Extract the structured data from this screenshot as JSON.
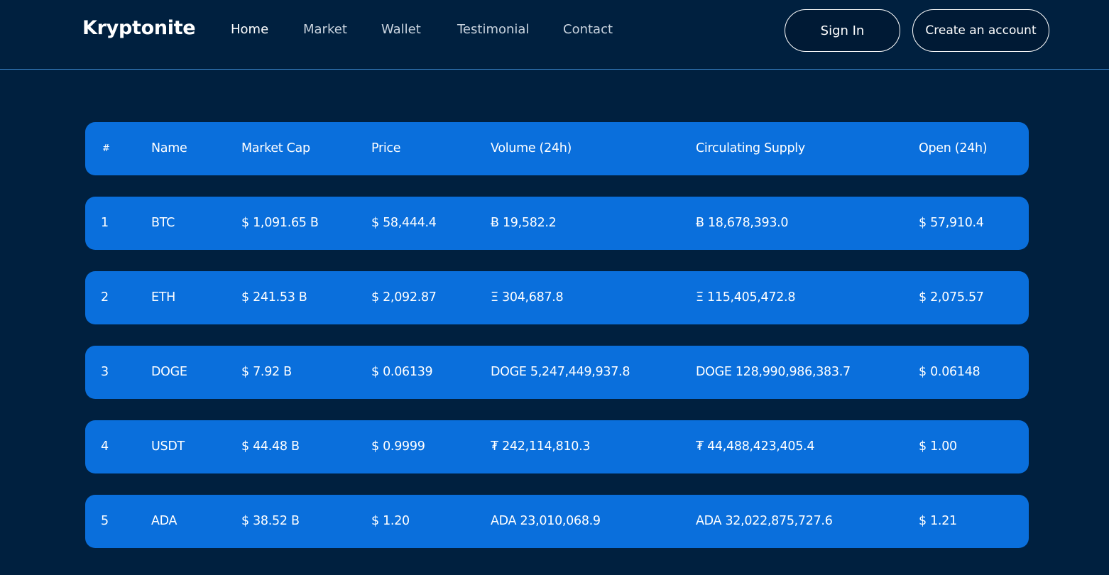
{
  "brand": {
    "name": "Kryptonite"
  },
  "nav": {
    "items": [
      {
        "label": "Home",
        "active": true
      },
      {
        "label": "Market",
        "active": false
      },
      {
        "label": "Wallet",
        "active": false
      },
      {
        "label": "Testimonial",
        "active": false
      },
      {
        "label": "Contact",
        "active": false
      }
    ]
  },
  "auth": {
    "sign_in_label": "Sign In",
    "create_account_label": "Create an account"
  },
  "table": {
    "headers": [
      "#",
      "Name",
      "Market Cap",
      "Price",
      "Volume (24h)",
      "Circulating Supply",
      "Open (24h)"
    ],
    "rows": [
      [
        "1",
        "BTC",
        "$ 1,091.65 B",
        "$ 58,444.4",
        "Ƀ 19,582.2",
        "Ƀ 18,678,393.0",
        "$ 57,910.4"
      ],
      [
        "2",
        "ETH",
        "$ 241.53 B",
        "$ 2,092.87",
        "Ξ 304,687.8",
        "Ξ 115,405,472.8",
        "$ 2,075.57"
      ],
      [
        "3",
        "DOGE",
        "$ 7.92 B",
        "$ 0.06139",
        "DOGE 5,247,449,937.8",
        "DOGE 128,990,986,383.7",
        "$ 0.06148"
      ],
      [
        "4",
        "USDT",
        "$ 44.48 B",
        "$ 0.9999",
        "₮ 242,114,810.3",
        "₮ 44,488,423,405.4",
        "$ 1.00"
      ],
      [
        "5",
        "ADA",
        "$ 38.52 B",
        "$ 1.20",
        "ADA 23,010,068.9",
        "ADA 32,022,875,727.6",
        "$ 1.21"
      ]
    ]
  },
  "colors": {
    "background": "#00203f",
    "row_fill": "#0a6fdc",
    "header_divider": "#3f8fd8"
  }
}
